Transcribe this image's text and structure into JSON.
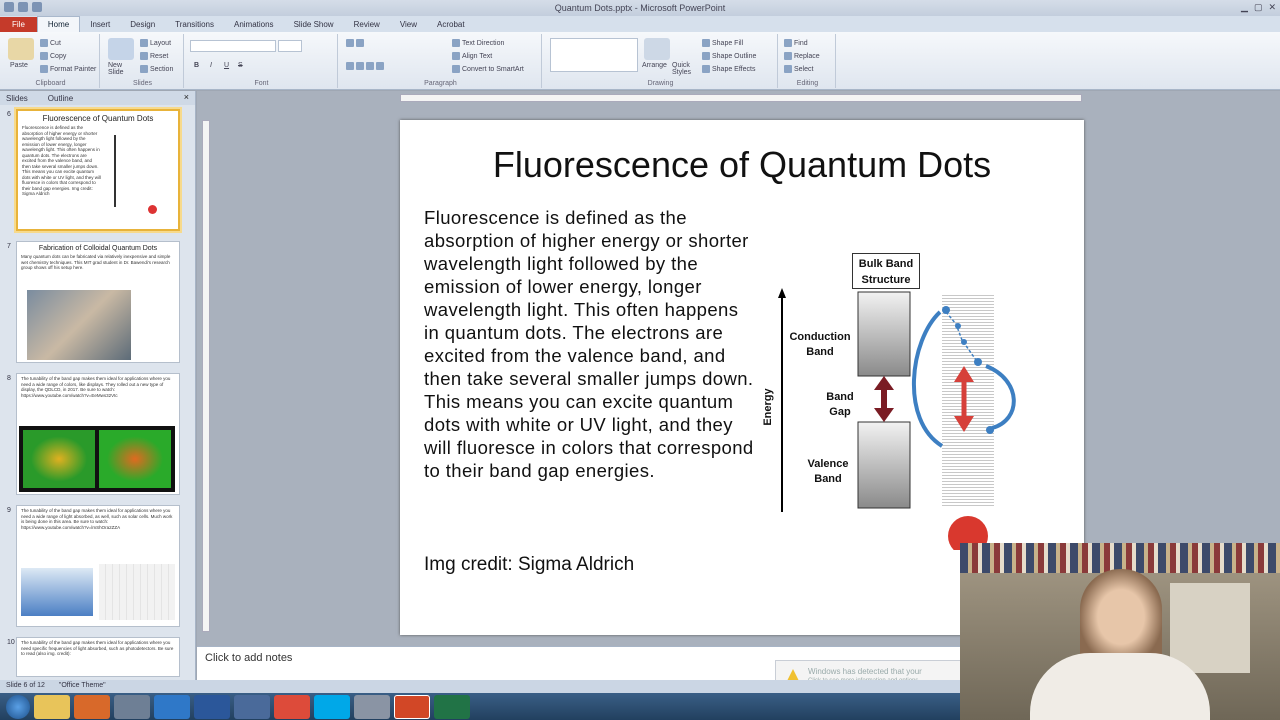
{
  "window": {
    "title": "Quantum Dots.pptx - Microsoft PowerPoint"
  },
  "ribbon_tabs": [
    "File",
    "Home",
    "Insert",
    "Design",
    "Transitions",
    "Animations",
    "Slide Show",
    "Review",
    "View",
    "Acrobat"
  ],
  "ribbon": {
    "clipboard": {
      "paste": "Paste",
      "cut": "Cut",
      "copy": "Copy",
      "format_painter": "Format Painter",
      "label": "Clipboard"
    },
    "slides": {
      "new_slide": "New Slide",
      "layout": "Layout",
      "reset": "Reset",
      "section": "Section",
      "label": "Slides"
    },
    "font": {
      "bold": "B",
      "italic": "I",
      "underline": "U",
      "strike": "S",
      "label": "Font"
    },
    "paragraph": {
      "text_direction": "Text Direction",
      "align_text": "Align Text",
      "convert_smartart": "Convert to SmartArt",
      "label": "Paragraph"
    },
    "drawing": {
      "arrange": "Arrange",
      "quick_styles": "Quick Styles",
      "shape_fill": "Shape Fill",
      "shape_outline": "Shape Outline",
      "shape_effects": "Shape Effects",
      "label": "Drawing"
    },
    "editing": {
      "find": "Find",
      "replace": "Replace",
      "select": "Select",
      "label": "Editing"
    }
  },
  "panel": {
    "tab_slides": "Slides",
    "tab_outline": "Outline",
    "close": "×"
  },
  "thumbnails": [
    {
      "num": "6",
      "title": "Fluorescence of Quantum Dots",
      "text": "Fluorescence is defined as the absorption of higher energy or shorter wavelength light followed by the emission of lower energy, longer wavelength light. This often happens in quantum dots. The electrons are excited from the valence band, and then take several smaller jumps down. This means you can excite quantum dots with white or UV light, and they will fluoresce in colors that correspond to their band gap energies. Img credit: Sigma Aldrich"
    },
    {
      "num": "7",
      "title": "Fabrication of Colloidal Quantum Dots",
      "text": "Many quantum dots can be fabricated via relatively inexpensive and simple wet chemistry techniques. This MIT grad student in Dr. Bawendi's research group shows off his setup here."
    },
    {
      "num": "8",
      "title": "",
      "text": "The tunability of the band gap makes them ideal for applications where you need a wide range of colors, like displays. They rolled out a new type of display, the QDLCD, in 2017. Be sure to watch: https://www.youtube.com/watch?v=EeMws32Vtc"
    },
    {
      "num": "9",
      "title": "",
      "text": "The tunability of the band gap makes them ideal for applications where you need a wide range of light absorbed, as well, such as solar cells. Much work is being done in this area. Be sure to watch: https://www.youtube.com/watch?v=lmShOra2ZZA"
    },
    {
      "num": "10",
      "title": "",
      "text": "The tunability of the band gap makes them ideal for applications where you need specific frequencies of light absorbed, such as photodetectors. Be sure to read (also img. credit):"
    }
  ],
  "slide": {
    "title": "Fluorescence of Quantum Dots",
    "body": "Fluorescence is defined as the absorption of higher energy or shorter wavelength light followed by the emission of lower energy, longer wavelength light. This often happens in quantum dots. The electrons are excited from the valence band, and then take several smaller jumps down. This means you can excite quantum dots with white or UV light, and they will fluoresce in colors that correspond to their band gap energies.",
    "credit": "Img credit: Sigma Aldrich",
    "diagram": {
      "bulk_label_1": "Bulk Band",
      "bulk_label_2": "Structure",
      "conduction_1": "Conduction",
      "conduction_2": "Band",
      "gap_1": "Band",
      "gap_2": "Gap",
      "valence_1": "Valence",
      "valence_2": "Band",
      "energy": "Energy"
    }
  },
  "notes": {
    "placeholder": "Click to add notes"
  },
  "notice": {
    "line1": "Windows has detected that your",
    "line2": "Click to see more information and options"
  },
  "status": {
    "slide_of": "Slide 6 of 12",
    "theme": "\"Office Theme\""
  },
  "colors": {
    "file_tab": "#c53a2a",
    "accent": "#2b579a"
  }
}
